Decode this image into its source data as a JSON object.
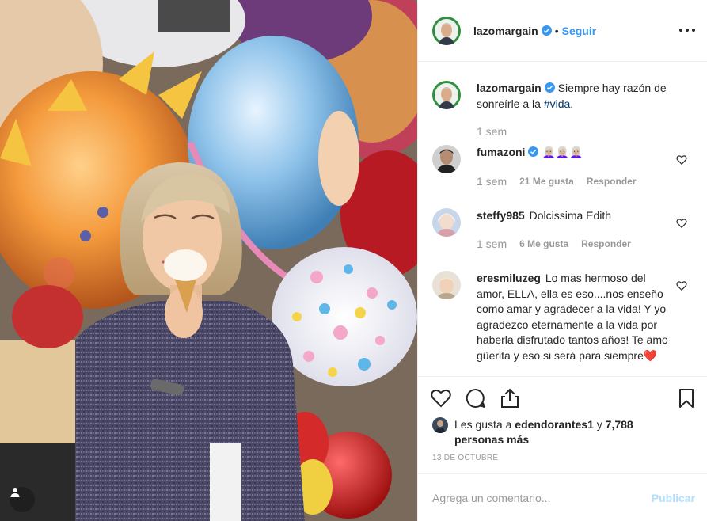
{
  "header": {
    "username": "lazomargain",
    "separator": "•",
    "follow_label": "Seguir",
    "more_icon": "more-horizontal-icon"
  },
  "caption": {
    "username": "lazomargain",
    "text_before": "Siempre hay razón de sonreírle a la ",
    "hashtag": "#vida",
    "text_after": ".",
    "time": "1 sem"
  },
  "comments": [
    {
      "username": "fumazoni",
      "verified": true,
      "text": "👩🏼‍🦳👩🏼‍🦳👩🏼‍🦳",
      "time": "1 sem",
      "likes": "21 Me gusta",
      "reply": "Responder"
    },
    {
      "username": "steffy985",
      "verified": false,
      "text": "Dolcissima Edith",
      "time": "1 sem",
      "likes": "6 Me gusta",
      "reply": "Responder"
    },
    {
      "username": "eresmiluzeg",
      "verified": false,
      "text": "Lo mas hermoso del amor, ELLA, ella es eso....nos enseño como amar y agradecer a la vida! Y yo agradezco eternamente a la vida por haberla disfrutado tantos años! Te amo güerita y eso si será para siempre❤️"
    }
  ],
  "actions": {
    "like_icon": "heart-icon",
    "comment_icon": "comment-icon",
    "share_icon": "share-icon",
    "save_icon": "bookmark-icon"
  },
  "likes": {
    "prefix": "Les gusta a ",
    "user": "edendorantes1",
    "middle": " y ",
    "others": "7,788 personas más"
  },
  "date": "13 DE OCTUBRE",
  "add_comment": {
    "placeholder": "Agrega un comentario...",
    "publish_label": "Publicar"
  },
  "colors": {
    "accent": "#3897f0",
    "publish_disabled": "#b2dffc",
    "muted": "#999999",
    "hashtag": "#003569",
    "border": "#efefef"
  }
}
